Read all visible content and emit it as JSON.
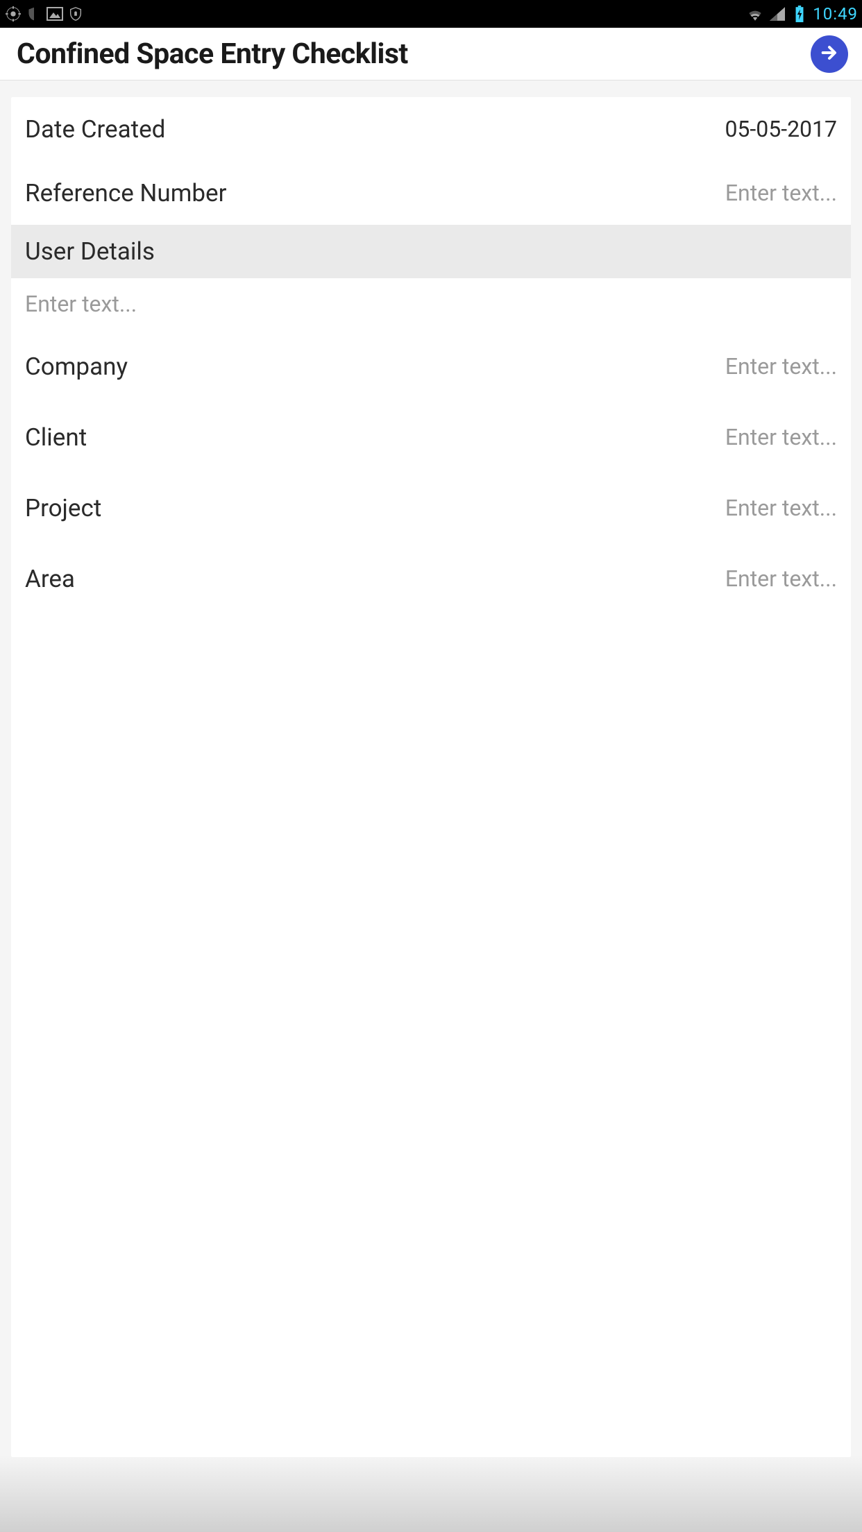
{
  "status_bar": {
    "time": "10:49"
  },
  "header": {
    "title": "Confined Space Entry Checklist"
  },
  "form": {
    "date_created": {
      "label": "Date Created",
      "value": "05-05-2017"
    },
    "reference_number": {
      "label": "Reference Number",
      "placeholder": "Enter text..."
    },
    "user_details_section": {
      "label": "User Details",
      "placeholder": "Enter text..."
    },
    "company": {
      "label": "Company",
      "placeholder": "Enter text..."
    },
    "client": {
      "label": "Client",
      "placeholder": "Enter text..."
    },
    "project": {
      "label": "Project",
      "placeholder": "Enter text..."
    },
    "area": {
      "label": "Area",
      "placeholder": "Enter text..."
    }
  }
}
